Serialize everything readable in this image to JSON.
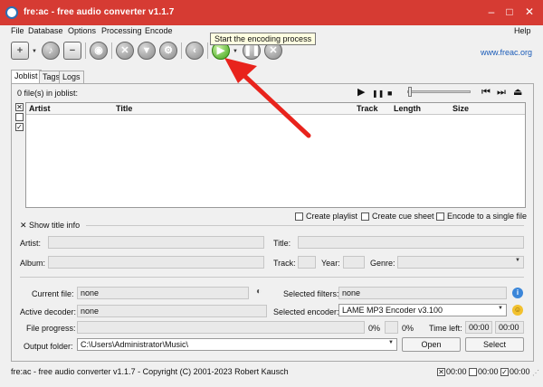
{
  "window": {
    "title": "fre:ac - free audio converter v1.1.7",
    "title_bar_color": "#d63b33",
    "controls": [
      "–",
      "□",
      "✕"
    ]
  },
  "menu": {
    "items": [
      "File",
      "Database",
      "Options",
      "Processing",
      "Encode"
    ],
    "help": "Help"
  },
  "toolbar": {
    "tooltip": "Start the encoding process",
    "link": "www.freac.org",
    "play_color": "#3fa317"
  },
  "tabs": [
    "Joblist",
    "Tags",
    "Logs"
  ],
  "joblist": {
    "count_label": "0 file(s) in joblist:",
    "columns": [
      "Artist",
      "Title",
      "Track",
      "Length",
      "Size"
    ],
    "transport": [
      "▶",
      "❚❚",
      "■",
      "⏮",
      "⏭",
      "⏏"
    ]
  },
  "options": {
    "create_playlist": "Create playlist",
    "create_cue_sheet": "Create cue sheet",
    "encode_single": "Encode to a single file"
  },
  "title_info": {
    "toggle": "Show title info",
    "artist": "Artist:",
    "title": "Title:",
    "album": "Album:",
    "track": "Track:",
    "year": "Year:",
    "genre": "Genre:"
  },
  "progress": {
    "current_file_label": "Current file:",
    "current_file": "none",
    "selected_filters_label": "Selected filters:",
    "selected_filters": "none",
    "active_decoder_label": "Active decoder:",
    "active_decoder": "none",
    "selected_encoder_label": "Selected encoder:",
    "selected_encoder": "LAME MP3 Encoder v3.100",
    "file_progress_label": "File progress:",
    "file_percent": "0%",
    "total_percent": "0%",
    "time_left_label": "Time left:",
    "time_left_1": "00:00",
    "time_left_2": "00:00",
    "output_folder_label": "Output folder:",
    "output_folder": "C:\\Users\\Administrator\\Music\\",
    "open": "Open",
    "select": "Select"
  },
  "status": {
    "text": "fre:ac - free audio converter v1.1.7 - Copyright (C) 2001-2023 Robert Kausch",
    "timer_1": "00:00",
    "timer_2": "00:00",
    "timer_3": "00:00"
  },
  "annotation_color": "#e8231c"
}
